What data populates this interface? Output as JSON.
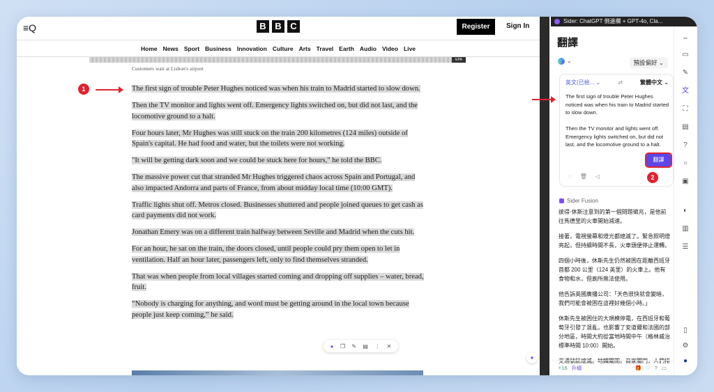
{
  "bbc": {
    "menu_icon": "≡Q",
    "logo_letters": [
      "B",
      "B",
      "C"
    ],
    "register_label": "Register",
    "signin_label": "Sign In",
    "nav": [
      "Home",
      "News",
      "Sport",
      "Business",
      "Innovation",
      "Culture",
      "Arts",
      "Travel",
      "Earth",
      "Audio",
      "Video",
      "Live"
    ],
    "photo_label": "EPA",
    "caption": "Customers wait at Lisbon's airport",
    "paragraphs": [
      "The first sign of trouble Peter Hughes noticed was when his train to Madrid started to slow down.",
      "Then the TV monitor and lights went off. Emergency lights switched on, but did not last, and the locomotive ground to a halt.",
      "Four hours later, Mr Hughes was still stuck on the train 200 kilometres (124 miles) outside of Spain's capital. He had food and water, but the toilets were not working.",
      "\"It will be getting dark soon and we could be stuck here for hours,\" he told the BBC.",
      "The massive power cut that stranded Mr Hughes triggered chaos across Spain and Portugal, and also impacted Andorra and parts of France, from about midday local time (10:00 GMT).",
      "Traffic lights shut off. Metros closed. Businesses shuttered and people joined queues to get cash as card payments did not work.",
      "Jonathan Emery was on a different train halfway between Seville and Madrid when the cuts hit.",
      "For an hour, he sat on the train, the doors closed, until people could pry them open to let in ventilation. Half an hour later, passengers left, only to find themselves stranded.",
      "That was when people from local villages started coming and dropping off supplies – water, bread, fruit.",
      "“Nobody is charging for anything, and word must be getting around in the local town because people just keep coming,” he said."
    ]
  },
  "markers": {
    "one": "1",
    "two": "2"
  },
  "sider": {
    "window_title": "Sider: ChatGPT 側邊欄 + GPT-4o, Cla...",
    "heading": "翻譯",
    "preferences": "預設偏好",
    "source_lang": "英文(已檢...",
    "target_lang": "繁體中文",
    "source_text": "The first sign of trouble Peter Hughes noticed was when his train to Madrid started to slow down.\n\nThen the TV monitor and lights went off. Emergency lights switched on, but did not last, and the locomotive ground to a halt.",
    "translate_button": "翻譯",
    "engine_label": "Sider Fusion",
    "result": [
      "彼得·休斯注意到的第一個問題徵兆，是他前往馬德里的火車開始減速。",
      "接著，電視螢幕和燈光都熄滅了。緊急照明燈亮起，但持續時間不長，火車頭便停止運轉。",
      "四個小時後，休斯先生仍然被困在距離西班牙首都 200 公里（124 英里）的火車上。他有食物和水，但廁所無法使用。",
      "他告訴英國廣播公司：「天色很快就會變暗，我們可能會被困在這裡好幾個小時。」",
      "休斯先生被困住的大規模停電，在西班牙和葡萄牙引發了混亂，也影響了安道爾和法國的部分地區，時間大約從當地時間中午（格林威治標準時間 10:00）開始。",
      "交通號誌熄滅。地鐵關閉。商家關門，人們排"
    ],
    "credits": "16",
    "upgrade": "升級"
  }
}
